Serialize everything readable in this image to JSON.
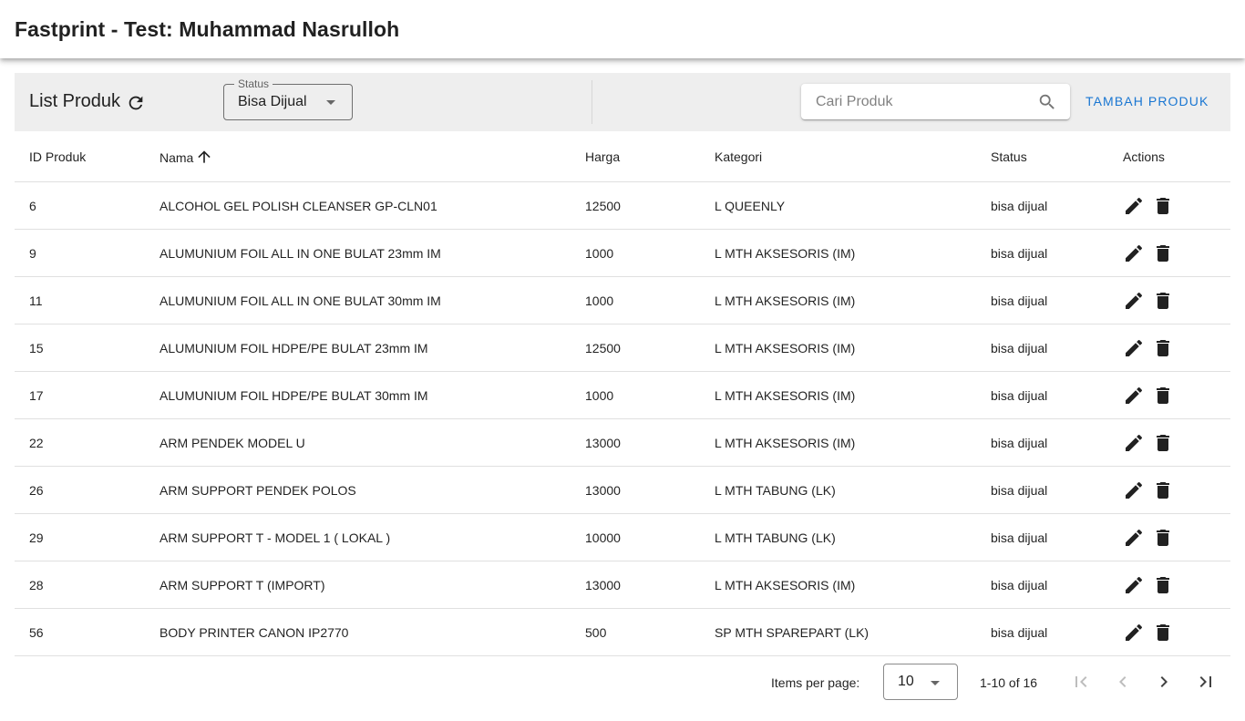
{
  "app": {
    "title": "Fastprint - Test: Muhammad Nasrulloh"
  },
  "toolbar": {
    "title": "List Produk",
    "refresh_icon": "refresh-icon",
    "status_filter": {
      "label": "Status",
      "value": "Bisa Dijual"
    },
    "search": {
      "placeholder": "Cari Produk",
      "value": "",
      "icon": "search-icon"
    },
    "add_button": "TAMBAH PRODUK"
  },
  "table": {
    "columns": [
      "ID Produk",
      "Nama",
      "Harga",
      "Kategori",
      "Status",
      "Actions"
    ],
    "sorted_column": "Nama",
    "sort_direction": "ascending",
    "rows": [
      {
        "id": "6",
        "nama": "ALCOHOL GEL POLISH CLEANSER GP-CLN01",
        "harga": "12500",
        "kategori": "L QUEENLY",
        "status": "bisa dijual"
      },
      {
        "id": "9",
        "nama": "ALUMUNIUM FOIL ALL IN ONE BULAT 23mm IM",
        "harga": "1000",
        "kategori": "L MTH AKSESORIS (IM)",
        "status": "bisa dijual"
      },
      {
        "id": "11",
        "nama": "ALUMUNIUM FOIL ALL IN ONE BULAT 30mm IM",
        "harga": "1000",
        "kategori": "L MTH AKSESORIS (IM)",
        "status": "bisa dijual"
      },
      {
        "id": "15",
        "nama": "ALUMUNIUM FOIL HDPE/PE BULAT 23mm IM",
        "harga": "12500",
        "kategori": "L MTH AKSESORIS (IM)",
        "status": "bisa dijual"
      },
      {
        "id": "17",
        "nama": "ALUMUNIUM FOIL HDPE/PE BULAT 30mm IM",
        "harga": "1000",
        "kategori": "L MTH AKSESORIS (IM)",
        "status": "bisa dijual"
      },
      {
        "id": "22",
        "nama": "ARM PENDEK MODEL U",
        "harga": "13000",
        "kategori": "L MTH AKSESORIS (IM)",
        "status": "bisa dijual"
      },
      {
        "id": "26",
        "nama": "ARM SUPPORT PENDEK POLOS",
        "harga": "13000",
        "kategori": "L MTH TABUNG (LK)",
        "status": "bisa dijual"
      },
      {
        "id": "29",
        "nama": "ARM SUPPORT T - MODEL 1 ( LOKAL )",
        "harga": "10000",
        "kategori": "L MTH TABUNG (LK)",
        "status": "bisa dijual"
      },
      {
        "id": "28",
        "nama": "ARM SUPPORT T (IMPORT)",
        "harga": "13000",
        "kategori": "L MTH AKSESORIS (IM)",
        "status": "bisa dijual"
      },
      {
        "id": "56",
        "nama": "BODY PRINTER CANON IP2770",
        "harga": "500",
        "kategori": "SP MTH SPAREPART (LK)",
        "status": "bisa dijual"
      }
    ],
    "row_action_icons": [
      "edit-icon",
      "delete-icon"
    ]
  },
  "paginator": {
    "items_per_page_label": "Items per page:",
    "items_per_page": "10",
    "range_label": "1-10 of 16",
    "buttons": [
      "first-page-icon",
      "previous-page-icon",
      "next-page-icon",
      "last-page-icon"
    ]
  },
  "colors": {
    "accent": "#1976d2",
    "toolbar_bg": "#eeeeee",
    "icon": "#212121",
    "disabled_icon": "#bdbdbd"
  }
}
